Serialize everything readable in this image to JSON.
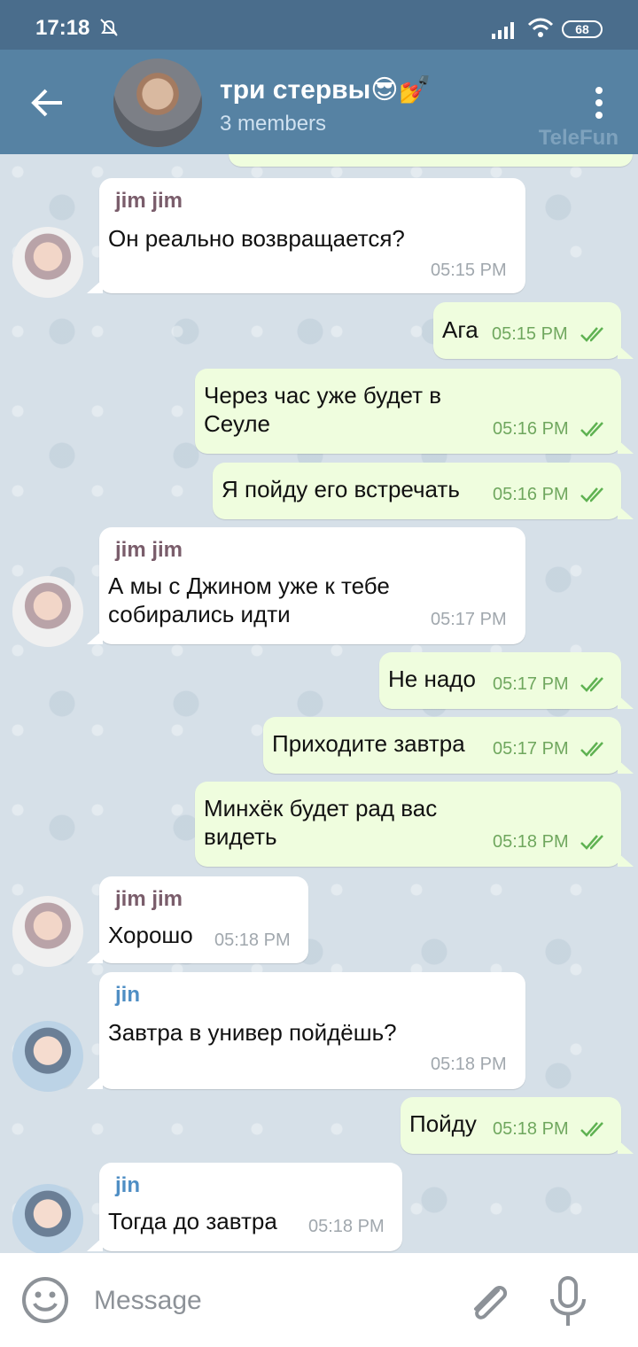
{
  "status_bar": {
    "time": "17:18",
    "battery": "68"
  },
  "header": {
    "title": "три стервы😎💅",
    "subtitle": "3 members",
    "watermark": "TeleFun"
  },
  "messages": [
    {
      "sender": "jim jim",
      "text": [
        "Он реально возвращается?"
      ],
      "time": "05:15 PM"
    },
    {
      "text": [
        "Ага"
      ],
      "time": "05:15 PM",
      "status": "read"
    },
    {
      "text": [
        "Через час уже будет в",
        "Сеуле"
      ],
      "time": "05:16 PM",
      "status": "read"
    },
    {
      "text": [
        "Я пойду его встречать"
      ],
      "time": "05:16 PM",
      "status": "read"
    },
    {
      "sender": "jim jim",
      "text": [
        "А мы с Джином уже к тебе",
        "собирались идти"
      ],
      "time": "05:17 PM"
    },
    {
      "text": [
        "Не надо"
      ],
      "time": "05:17 PM",
      "status": "read"
    },
    {
      "text": [
        "Приходите завтра"
      ],
      "time": "05:17 PM",
      "status": "read"
    },
    {
      "text": [
        "Минхёк будет рад вас",
        "видеть"
      ],
      "time": "05:18 PM",
      "status": "read"
    },
    {
      "sender": "jim jim",
      "text": [
        "Хорошо"
      ],
      "time": "05:18 PM"
    },
    {
      "sender": "jin",
      "text": [
        "Завтра в универ пойдёшь?"
      ],
      "time": "05:18 PM"
    },
    {
      "text": [
        "Пойду"
      ],
      "time": "05:18 PM",
      "status": "read"
    },
    {
      "sender": "jin",
      "text": [
        "Тогда до завтра"
      ],
      "time": "05:18 PM"
    }
  ],
  "input": {
    "placeholder": "Message"
  },
  "colors": {
    "header": "#5682a3",
    "status_bar": "#4a6d8c",
    "incoming_bubble": "#ffffff",
    "outgoing_bubble": "#effdde",
    "read_ticks": "#5fb252",
    "sender_jim": "#7a5d6b",
    "sender_jin": "#4f8ec4"
  },
  "icons": [
    "back-arrow-icon",
    "more-vertical-icon",
    "emoji-icon",
    "paperclip-icon",
    "microphone-icon",
    "double-check-icon",
    "bell-off-icon",
    "signal-icon",
    "wifi-icon",
    "battery-icon"
  ]
}
